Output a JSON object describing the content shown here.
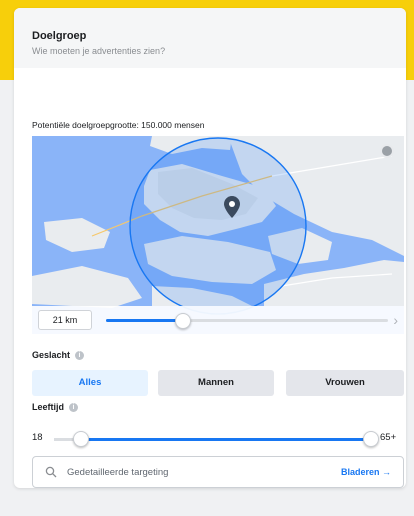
{
  "header": {
    "title": "Doelgroep",
    "subtitle": "Wie moeten je advertenties zien?"
  },
  "reach": {
    "text": "Potentiële doelgroepgrootte: 150.000 mensen"
  },
  "map": {
    "radius_label": "21 km",
    "radius_level": 0.27,
    "marker_icon": "location-pin-icon"
  },
  "gender": {
    "label": "Geslacht",
    "options": [
      "Alles",
      "Mannen",
      "Vrouwen"
    ],
    "selected": "Alles"
  },
  "age": {
    "label": "Leeftijd",
    "min": "18",
    "max": "65+"
  },
  "targeting": {
    "placeholder": "Gedetailleerde targeting",
    "browse_label": "Bladeren"
  },
  "colors": {
    "accent": "#1877f2",
    "brand_yellow": "#f7cf0b",
    "water": "#8ab4f8",
    "land": "#e9ecef"
  }
}
